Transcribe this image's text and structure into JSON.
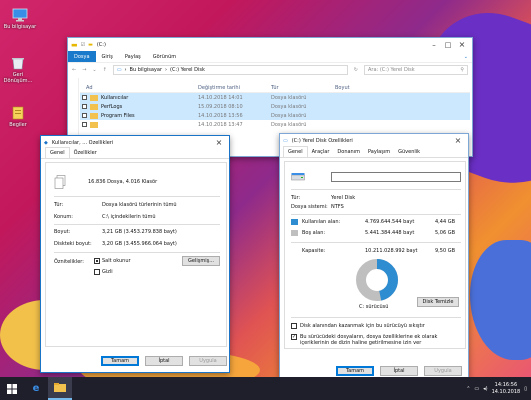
{
  "desktop": {
    "icons": [
      {
        "label": "Bu bilgisayar"
      },
      {
        "label": "Geri Dönüşüm..."
      },
      {
        "label": "Begiler"
      }
    ]
  },
  "explorer": {
    "title": "(C:)",
    "ribbon_tabs": [
      "Dosya",
      "Giriş",
      "Paylaş",
      "Görünüm"
    ],
    "breadcrumb": [
      "Bu bilgisayar",
      "(C:) Yerel Disk"
    ],
    "search_placeholder": "Ara: (C:) Yerel Disk",
    "columns": [
      "Ad",
      "Değiştirme tarihi",
      "Tür",
      "Boyut"
    ],
    "rows": [
      {
        "name": "Kullanıcılar",
        "date": "14.10.2018 14:01",
        "type": "Dosya klasörü"
      },
      {
        "name": "PerfLogs",
        "date": "15.09.2018 08:10",
        "type": "Dosya klasörü"
      },
      {
        "name": "Program Files",
        "date": "14.10.2018 13:56",
        "type": "Dosya klasörü"
      },
      {
        "name": "",
        "date": "14.10.2018 13:47",
        "type": "Dosya klasörü"
      }
    ]
  },
  "folder_props": {
    "title": "Kullanıcılar, ... Özellikleri",
    "tabs": [
      "Genel",
      "Özellikler"
    ],
    "summary": "16.836 Dosya, 4.016 Klasör",
    "fields": [
      {
        "label": "Tür:",
        "value": "Dosya klasörü türlerinin tümü"
      },
      {
        "label": "Konum:",
        "value": "C:\\ içindekilerin tümü"
      },
      {
        "label": "Boyut:",
        "value": "3,21 GB (3.453.279.838 bayt)"
      },
      {
        "label": "Diskteki boyut:",
        "value": "3,20 GB (3.455.966.064 bayt)"
      }
    ],
    "attributes_label": "Öznitelikler:",
    "readonly_label": "Salt okunur",
    "hidden_label": "Gizli",
    "advanced_button": "Gelişmiş...",
    "ok": "Tamam",
    "cancel": "İptal",
    "apply": "Uygula"
  },
  "disk_props": {
    "title": "(C:) Yerel Disk Özellikleri",
    "tabs": [
      "Genel",
      "Araçlar",
      "Donanım",
      "Paylaşım",
      "Güvenlik"
    ],
    "type_label": "Tür:",
    "type_value": "Yerel Disk",
    "fs_label": "Dosya sistemi:",
    "fs_value": "NTFS",
    "used_label": "Kullanılan alan:",
    "used_bytes": "4.769.644.544 bayt",
    "used_gb": "4,44 GB",
    "free_label": "Boş alan:",
    "free_bytes": "5.441.384.448 bayt",
    "free_gb": "5,06 GB",
    "capacity_label": "Kapasite:",
    "capacity_bytes": "10.211.028.992 bayt",
    "capacity_gb": "9,50 GB",
    "used_fraction": 0.467,
    "drive_label": "C: sürücüsü",
    "cleanup_button": "Disk Temizle",
    "compress_label": "Disk alanından kazanmak için bu sürücüyü sıkıştır",
    "index_label": "Bu sürücüdeki dosyaların, dosya özelliklerine ek olarak içeriklerinin de dizin haline getirilmesine izin ver",
    "ok": "Tamam",
    "cancel": "İptal",
    "apply": "Uygula",
    "colors": {
      "used": "#2e8cd0",
      "free": "#bfbfbf"
    }
  },
  "taskbar": {
    "time": "14:16:56",
    "date": "14.10.2018"
  }
}
